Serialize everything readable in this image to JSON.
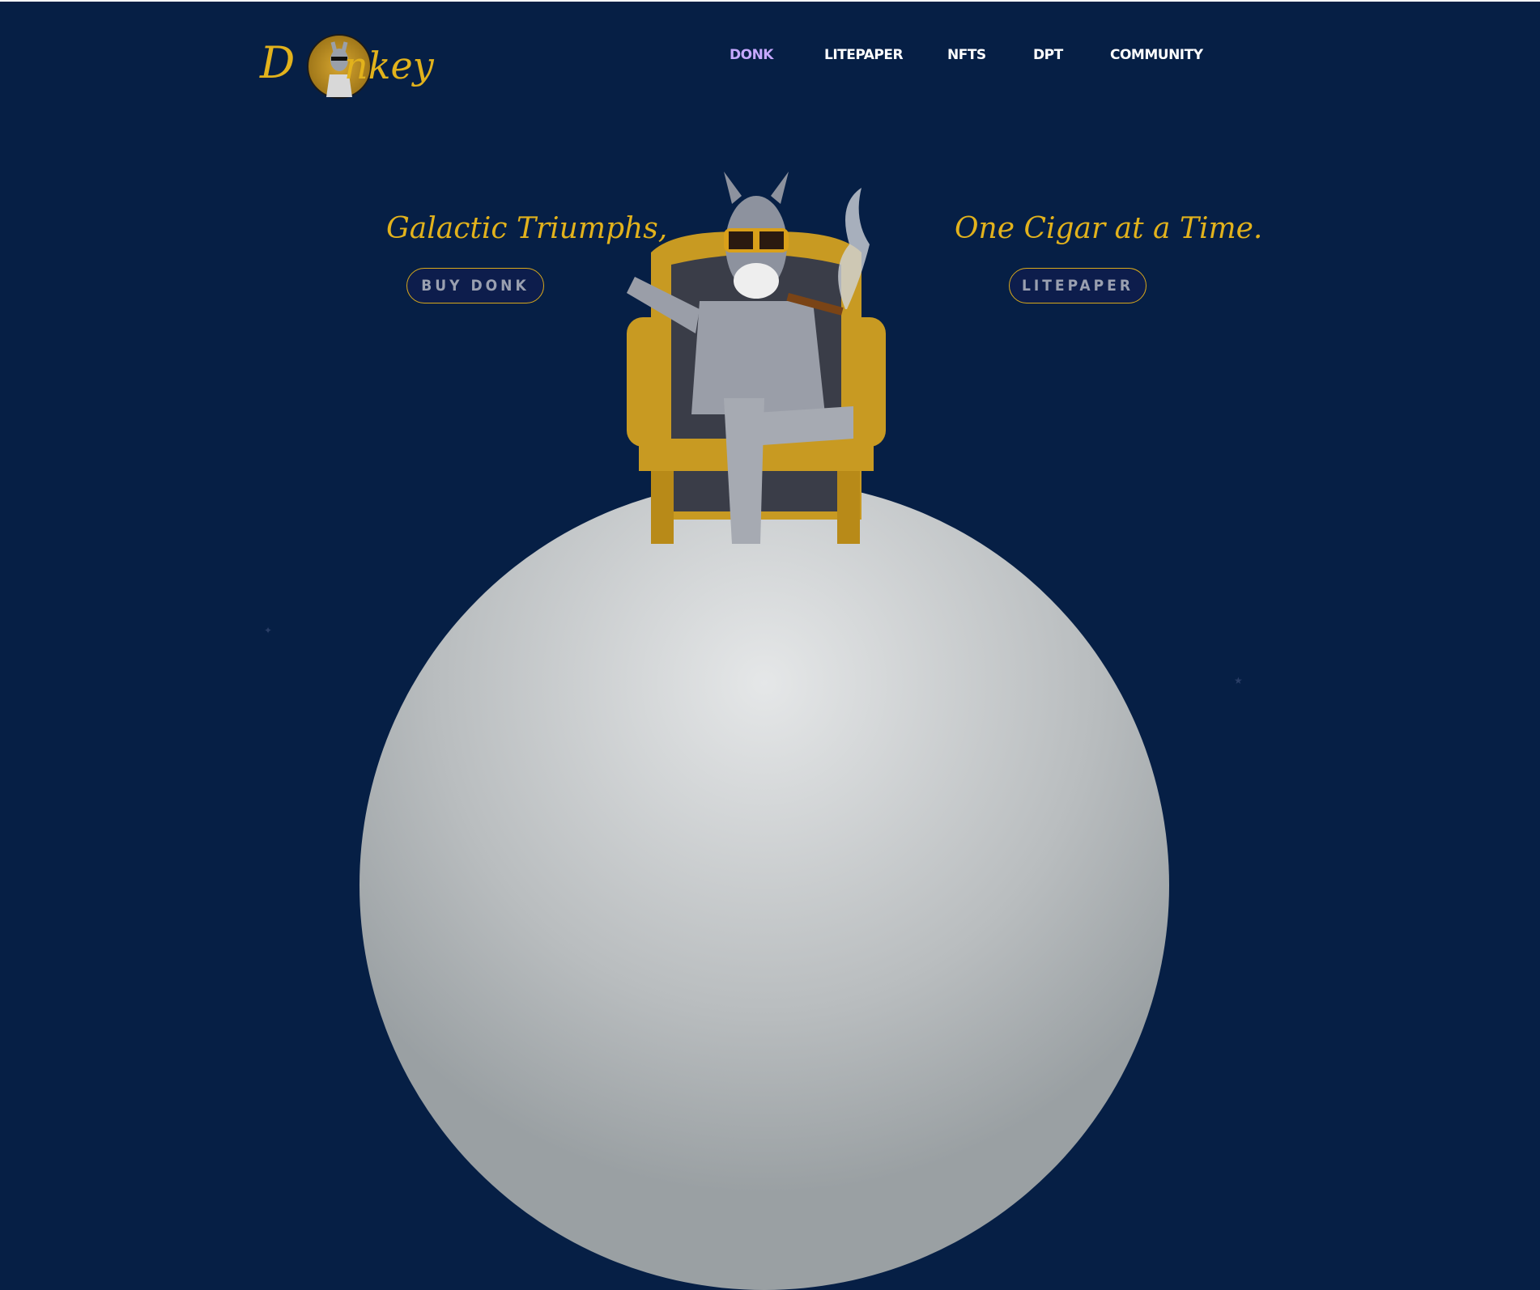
{
  "logo": {
    "text_left": "D",
    "text_right": "nkey"
  },
  "nav": [
    {
      "label": "DONK",
      "active": true
    },
    {
      "label": "LITEPAPER",
      "active": false
    },
    {
      "label": "NFTS",
      "active": false
    },
    {
      "label": "DPT",
      "active": false
    },
    {
      "label": "COMMUNITY",
      "active": false
    }
  ],
  "hero": {
    "tagline_left": "Galactic Triumphs,",
    "tagline_right": "One Cigar at a Time.",
    "buy_button": "BUY DONK",
    "litepaper_button": "LITEPAPER"
  },
  "colors": {
    "background": "#061f45",
    "accent": "#e2b21c",
    "nav_active": "#c6a8ff"
  }
}
